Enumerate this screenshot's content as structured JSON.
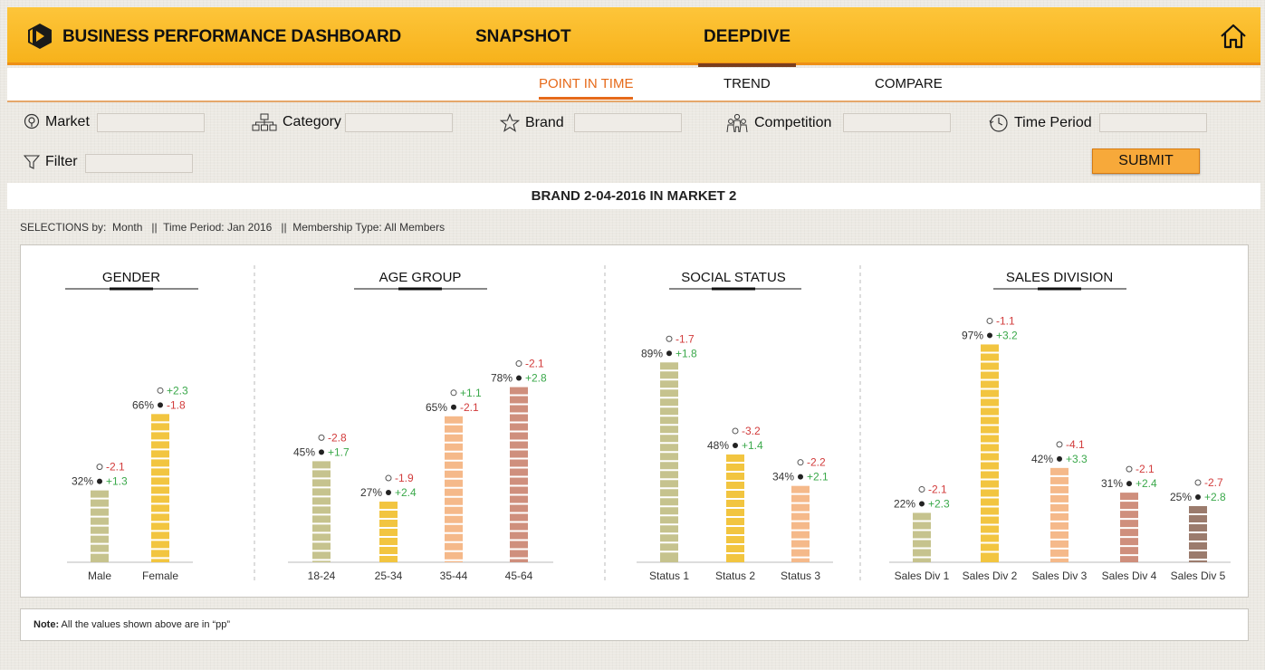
{
  "header": {
    "title": "BUSINESS PERFORMANCE DASHBOARD",
    "tabs": [
      {
        "label": "SNAPSHOT",
        "active": false
      },
      {
        "label": "DEEPDIVE",
        "active": true
      }
    ]
  },
  "subnav": {
    "tabs": [
      {
        "label": "POINT IN TIME",
        "active": true
      },
      {
        "label": "TREND",
        "active": false
      },
      {
        "label": "COMPARE",
        "active": false
      }
    ]
  },
  "filters": {
    "market": {
      "label": "Market",
      "value": ""
    },
    "category": {
      "label": "Category",
      "value": ""
    },
    "brand": {
      "label": "Brand",
      "value": ""
    },
    "competition": {
      "label": "Competition",
      "value": ""
    },
    "time_period": {
      "label": "Time Period",
      "value": ""
    },
    "filter": {
      "label": "Filter",
      "value": ""
    },
    "submit_label": "SUBMIT"
  },
  "report_title": "BRAND 2-04-2016 IN MARKET 2",
  "selections": "SELECTIONS by:  Month   ||  Time Period: Jan 2016   ||  Membership Type: All Members",
  "note": {
    "bold": "Note:",
    "text": " All the values shown above are in “pp”"
  },
  "colors": {
    "accent": "#f7b21b",
    "active_subtab": "#e66a1a",
    "positive": "#3aa84a",
    "negative": "#d23b3b"
  },
  "chart_data": [
    {
      "type": "bar",
      "title": "GENDER",
      "categories": [
        "Male",
        "Female"
      ],
      "values": [
        32,
        66
      ],
      "open_change": [
        "-2.1",
        "+2.3"
      ],
      "filled_change": [
        "+1.3",
        "-1.8"
      ],
      "colors": [
        "#c6c38e",
        "#f2c540"
      ],
      "unit": "%"
    },
    {
      "type": "bar",
      "title": "AGE GROUP",
      "categories": [
        "18-24",
        "25-34",
        "35-44",
        "45-64"
      ],
      "values": [
        45,
        27,
        65,
        78
      ],
      "open_change": [
        "-2.8",
        "-1.9",
        "+1.1",
        "-2.1"
      ],
      "filled_change": [
        "+1.7",
        "+2.4",
        "-2.1",
        "+2.8"
      ],
      "colors": [
        "#c6c38e",
        "#f2c540",
        "#f5b98a",
        "#cf8f7d"
      ],
      "unit": "%"
    },
    {
      "type": "bar",
      "title": "SOCIAL STATUS",
      "categories": [
        "Status 1",
        "Status 2",
        "Status 3"
      ],
      "values": [
        89,
        48,
        34
      ],
      "open_change": [
        "-1.7",
        "-3.2",
        "-2.2"
      ],
      "filled_change": [
        "+1.8",
        "+1.4",
        "+2.1"
      ],
      "colors": [
        "#c6c38e",
        "#f2c540",
        "#f5b98a"
      ],
      "unit": "%"
    },
    {
      "type": "bar",
      "title": "SALES DIVISION",
      "categories": [
        "Sales Div 1",
        "Sales Div 2",
        "Sales Div 3",
        "Sales Div 4",
        "Sales Div 5"
      ],
      "values": [
        22,
        97,
        42,
        31,
        25
      ],
      "open_change": [
        "-2.1",
        "-1.1",
        "-4.1",
        "-2.1",
        "-2.7"
      ],
      "filled_change": [
        "+2.3",
        "+3.2",
        "+3.3",
        "+2.4",
        "+2.8"
      ],
      "colors": [
        "#c6c38e",
        "#f2c540",
        "#f5b98a",
        "#cf8f7d",
        "#9b7b6d"
      ],
      "unit": "%"
    }
  ]
}
